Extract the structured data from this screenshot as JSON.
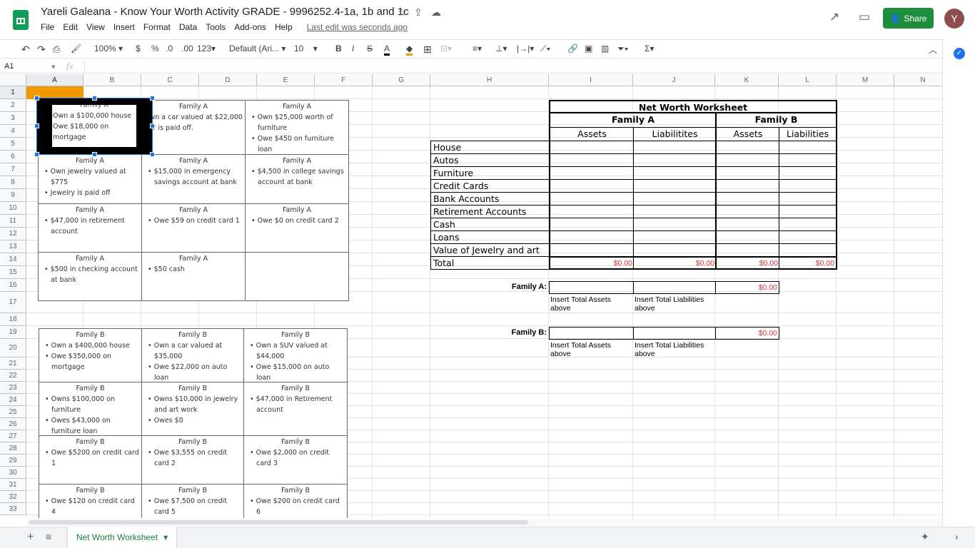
{
  "header": {
    "title": "Yareli Galeana - Know Your Worth Activity GRADE - 9996252.4-1a, 1b and 1c",
    "menus": [
      "File",
      "Edit",
      "View",
      "Insert",
      "Format",
      "Data",
      "Tools",
      "Add-ons",
      "Help"
    ],
    "last_edit": "Last edit was seconds ago",
    "share": "Share",
    "avatar": "Y"
  },
  "toolbar": {
    "zoom": "100%",
    "currency": "$",
    "percent": "%",
    "dec_less": ".0",
    "dec_more": ".00",
    "format_more": "123",
    "font": "Default (Ari...",
    "font_size": "10",
    "bold": "B",
    "italic": "I",
    "strike": "S",
    "text_color": "A"
  },
  "formula_bar": {
    "cell_ref": "A1",
    "fx": "fx",
    "value": ""
  },
  "columns": [
    "A",
    "B",
    "C",
    "D",
    "E",
    "F",
    "G",
    "H",
    "I",
    "J",
    "K",
    "L",
    "M",
    "N"
  ],
  "rows": [
    "1",
    "2",
    "3",
    "4",
    "5",
    "6",
    "7",
    "8",
    "9",
    "10",
    "11",
    "12",
    "13",
    "14",
    "15",
    "16",
    "17",
    "18",
    "19",
    "20",
    "21",
    "22",
    "23",
    "24",
    "25",
    "26",
    "27",
    "28",
    "29",
    "30",
    "31",
    "32",
    "33"
  ],
  "family_a_cards": [
    {
      "title": "Family A",
      "lines": [
        "Own a $100,000 house",
        "Owe $18,000 on mortgage"
      ],
      "plain": true
    },
    {
      "title": "Family A",
      "lines": [
        "Own a car valued at $22,000",
        "Car is paid off."
      ],
      "plain": true
    },
    {
      "title": "Family A",
      "lines": [
        "Own $25,000 worth of furniture",
        "Owe $450 on furniture loan"
      ]
    },
    {
      "title": "Family A",
      "lines": [
        "Own jewelry valued at $775",
        "Jewelry is paid off"
      ]
    },
    {
      "title": "Family A",
      "lines": [
        "$15,000 in emergency savings account at bank"
      ]
    },
    {
      "title": "Family A",
      "lines": [
        "$4,500 in college savings account at bank"
      ]
    },
    {
      "title": "Family A",
      "lines": [
        "$47,000 in retirement account"
      ]
    },
    {
      "title": "Family A",
      "lines": [
        "Owe $59 on credit card 1"
      ]
    },
    {
      "title": "Family A",
      "lines": [
        "Owe $0 on credit card 2"
      ]
    },
    {
      "title": "Family A",
      "lines": [
        "$500 in checking account at bank"
      ]
    },
    {
      "title": "Family A",
      "lines": [
        "$50 cash"
      ]
    },
    {
      "title": "",
      "lines": []
    }
  ],
  "family_b_cards": [
    {
      "title": "Family B",
      "lines": [
        "Own a $400,000 house",
        "Owe $350,000 on mortgage"
      ]
    },
    {
      "title": "Family B",
      "lines": [
        "Own a car valued at $35,000",
        "Owe $22,000 on auto loan"
      ]
    },
    {
      "title": "Family B",
      "lines": [
        "Own a SUV valued at $44,000",
        "Owe $15,000 on auto loan"
      ]
    },
    {
      "title": "Family B",
      "lines": [
        "Owns $100,000 on furniture",
        "Owes $43,000 on furniture loan"
      ]
    },
    {
      "title": "Family B",
      "lines": [
        "Owns $10,000 in jewelry and art work",
        "Owes $0"
      ]
    },
    {
      "title": "Family B",
      "lines": [
        "$47,000 in Retirement account"
      ]
    },
    {
      "title": "Family B",
      "lines": [
        "Owe $5200 on credit card 1"
      ]
    },
    {
      "title": "Family B",
      "lines": [
        "Owe $3,555 on credit card 2"
      ]
    },
    {
      "title": "Family B",
      "lines": [
        "Owe $2,000 on credit card 3"
      ]
    },
    {
      "title": "Family B",
      "lines": [
        "Owe $120 on credit card 4"
      ]
    },
    {
      "title": "Family B",
      "lines": [
        "Owe $7,500 on credit card 5"
      ]
    },
    {
      "title": "Family B",
      "lines": [
        "Owe $200 on credit card 6"
      ]
    }
  ],
  "worksheet": {
    "title": "Net Worth Worksheet",
    "family_a": "Family A",
    "family_b": "Family B",
    "assets": "Assets",
    "liab_a": "Liabilitites",
    "liab_b": "Liabilities",
    "categories": [
      "House",
      "Autos",
      "Furniture",
      "Credit Cards",
      "Bank Accounts",
      "Retirement Accounts",
      "Cash",
      "Loans",
      "Value of Jewelry and art"
    ],
    "total_label": "Total",
    "totals": [
      "$0.00",
      "$0.00",
      "$0.00",
      "$0.00"
    ],
    "summary": [
      {
        "label": "Family A:",
        "net": "$0.00"
      },
      {
        "label": "Family B:",
        "net": "$0.00"
      }
    ],
    "hint_assets": "Insert Total Assets above",
    "hint_liab": "Insert Total Liabilities above"
  },
  "sheet_tab": "Net Worth Worksheet"
}
